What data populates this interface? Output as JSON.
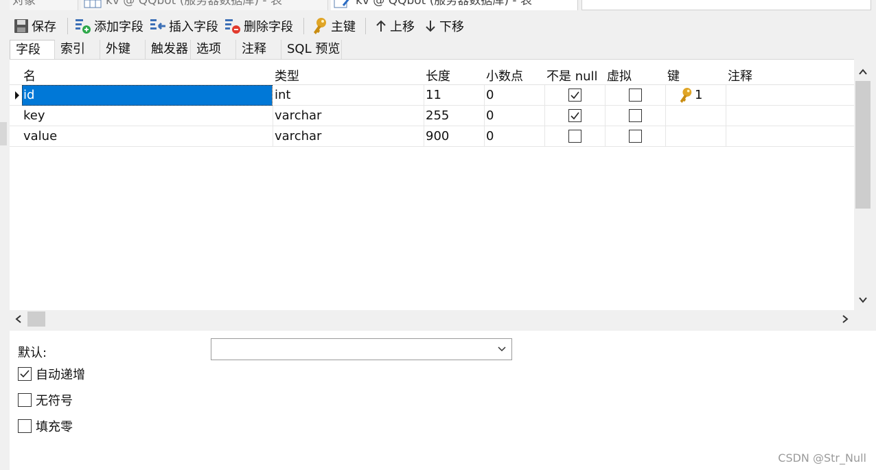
{
  "doc_tabs": [
    {
      "label": "对象"
    },
    {
      "label": "kv @ QQbot (服务器数据库) - 表"
    },
    {
      "label": "kv @ QQbot (服务器数据库) - 表"
    }
  ],
  "toolbar": {
    "save": "保存",
    "add_field": "添加字段",
    "insert_field": "插入字段",
    "delete_field": "删除字段",
    "primary_key": "主键",
    "move_up": "上移",
    "move_down": "下移"
  },
  "subtabs": [
    "字段",
    "索引",
    "外键",
    "触发器",
    "选项",
    "注释",
    "SQL 预览"
  ],
  "grid": {
    "columns": [
      "名",
      "类型",
      "长度",
      "小数点",
      "不是 null",
      "虚拟",
      "键",
      "注释"
    ],
    "rows": [
      {
        "name": "id",
        "type": "int",
        "length": "11",
        "decimals": "0",
        "not_null": true,
        "virtual": false,
        "key": "1",
        "comment": ""
      },
      {
        "name": "key",
        "type": "varchar",
        "length": "255",
        "decimals": "0",
        "not_null": true,
        "virtual": false,
        "key": "",
        "comment": ""
      },
      {
        "name": "value",
        "type": "varchar",
        "length": "900",
        "decimals": "0",
        "not_null": false,
        "virtual": false,
        "key": "",
        "comment": ""
      }
    ]
  },
  "props": {
    "default_label": "默认:",
    "default_value": "",
    "auto_increment": {
      "label": "自动递增",
      "checked": true
    },
    "unsigned": {
      "label": "无符号",
      "checked": false
    },
    "zerofill": {
      "label": "填充零",
      "checked": false
    }
  },
  "watermark": "CSDN @Str_Null",
  "colors": {
    "selection": "#0078d7",
    "key_icon": "#e0a526"
  }
}
